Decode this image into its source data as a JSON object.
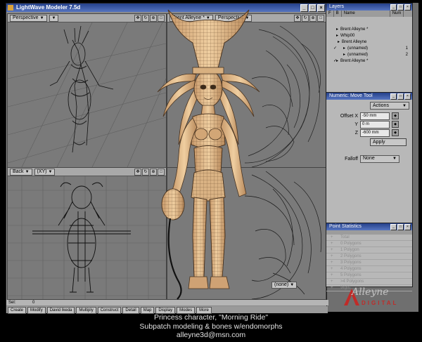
{
  "window": {
    "title": "LightWave Modeler 7.5d",
    "min": "_",
    "max": "□",
    "close": "×"
  },
  "viewports": {
    "top_left": {
      "label": "Perspective"
    },
    "top_right": {
      "layer_dropdown": "Brent Alleyne *",
      "label": "Perspective"
    },
    "bottom_left": {
      "label": "Back",
      "axis": "(XY)"
    },
    "bottom_right": {
      "shading": "(none)"
    }
  },
  "status": {
    "label": "Sel:",
    "value": "0"
  },
  "menubar": [
    "Create",
    "Modify",
    "David Ikeda",
    "Multiply",
    "Construct",
    "Detail",
    "Map",
    "Display",
    "Modes",
    "More"
  ],
  "layers": {
    "title": "Layers",
    "columns": [
      "F",
      "B",
      "Name",
      "Num"
    ],
    "rows": [
      {
        "name": "Brent Alleyne *",
        "num": "",
        "indent": 20
      },
      {
        "name": "Whip00",
        "num": "",
        "indent": 20
      },
      {
        "name": "Brent Alleyne",
        "num": "",
        "indent": 22
      },
      {
        "name": "(unnamed)",
        "num": "1",
        "indent": 30,
        "check": "✓"
      },
      {
        "name": "(unnamed)",
        "num": "2",
        "indent": 30
      },
      {
        "name": "Brent Alleyne *",
        "num": "",
        "indent": 20,
        "check": "✓"
      }
    ]
  },
  "numeric": {
    "title": "Numeric: Move Tool",
    "actions": "Actions",
    "offset_x_label": "Offset X",
    "offset_x": "-50 mm",
    "y_label": "Y",
    "y": "0 m",
    "z_label": "Z",
    "z": "-600 mm",
    "apply": "Apply",
    "falloff_label": "Falloff",
    "falloff": "None"
  },
  "point_stats": {
    "title": "Point Statistics",
    "rows": [
      "Total",
      "0 Polygons",
      "1 Polygon",
      "2 Polygons",
      "3 Polygons",
      "4 Polygons",
      "5 Polygons",
      ">4 Polygons",
      "Wght"
    ]
  },
  "logo": {
    "main": "Alleyne",
    "sub": "DIGITAL"
  },
  "caption": {
    "line1": "Princess character, \"Morning Ride\"",
    "line2": "Subpatch modeling & bones w/endomorphs",
    "line3": "alleyne3d@msn.com"
  },
  "colors": {
    "titlebar": "#24408a",
    "logo_red": "#c02b28",
    "skin": "#e2b98a"
  }
}
